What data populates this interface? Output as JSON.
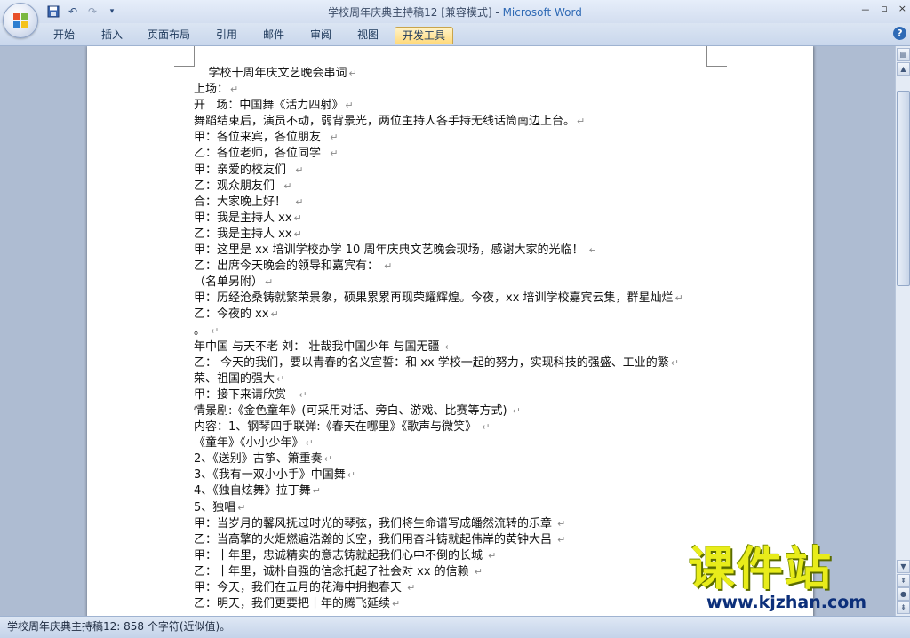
{
  "window": {
    "title": "学校周年庆典主持稿12 [兼容模式] - ",
    "app_name": "Microsoft Word",
    "controls": [
      "－",
      "▫",
      "×"
    ]
  },
  "quick_access": [
    "save-icon",
    "undo-icon",
    "redo-icon",
    "customize-icon"
  ],
  "ribbon": {
    "tabs": [
      {
        "label": "开始"
      },
      {
        "label": "插入"
      },
      {
        "label": "页面布局"
      },
      {
        "label": "引用"
      },
      {
        "label": "邮件"
      },
      {
        "label": "审阅"
      },
      {
        "label": "视图"
      },
      {
        "label": "开发工具",
        "active": true
      }
    ],
    "help": "?"
  },
  "document": {
    "lines": [
      "    学校十周年庆文艺晚会串词",
      "上场：",
      "开   场：中国舞《活力四射》",
      "舞蹈结束后，演员不动，弱背景光，两位主持人各手持无线话筒南边上台。",
      "甲：各位来宾，各位朋友  ",
      "乙：各位老师，各位同学  ",
      "甲：亲爱的校友们  ",
      "乙：观众朋友们  ",
      "合：大家晚上好！  ",
      "甲：我是主持人 xx",
      "乙：我是主持人 xx",
      "甲：这里是 xx 培训学校办学 10 周年庆典文艺晚会现场，感谢大家的光临！ ",
      "乙：出席今天晚会的领导和嘉宾有： ",
      "（名单另附）",
      "甲：历经沧桑铸就繁荣景象，硕果累累再现荣耀辉煌。今夜，xx 培训学校嘉宾云集，群星灿烂",
      "乙：今夜的 xx",
      "。 ",
      "年中国 与天不老 刘： 壮哉我中国少年 与国无疆 ",
      "乙： 今天的我们，要以青春的名义宣誓：和 xx 学校一起的努力，实现科技的强盛、工业的繁",
      "荣、祖国的强大",
      "甲：接下来请欣赏   ",
      "情景剧:《金色童年》(可采用对话、旁白、游戏、比赛等方式) ",
      "内容：1、钢琴四手联弹:《春天在哪里》《歌声与微笑》 ",
      "《童年》《小小少年》",
      "2、《送别》古筝、箫重奏",
      "3、《我有一双小小手》中国舞",
      "4、《独自炫舞》拉丁舞",
      "5、独唱",
      "甲：当岁月的馨风抚过时光的琴弦，我们将生命谱写成皤然流转的乐章 ",
      "乙：当高擎的火炬燃遍浩瀚的长空，我们用奋斗铸就起伟岸的黄钟大吕 ",
      "甲：十年里，忠诚精实的意志铸就起我们心中不倒的长城 ",
      "乙：十年里，诚朴自强的信念托起了社会对 xx 的信赖 ",
      "甲：今天，我们在五月的花海中拥抱春天 ",
      "乙：明天，我们更要把十年的腾飞延续"
    ],
    "paragraph_mark": "↵"
  },
  "status_bar": {
    "text": "学校周年庆典主持稿12: 858 个字符(近似值)。"
  },
  "watermark": {
    "cn": "课件站",
    "url": "www.kjzhan.com"
  }
}
